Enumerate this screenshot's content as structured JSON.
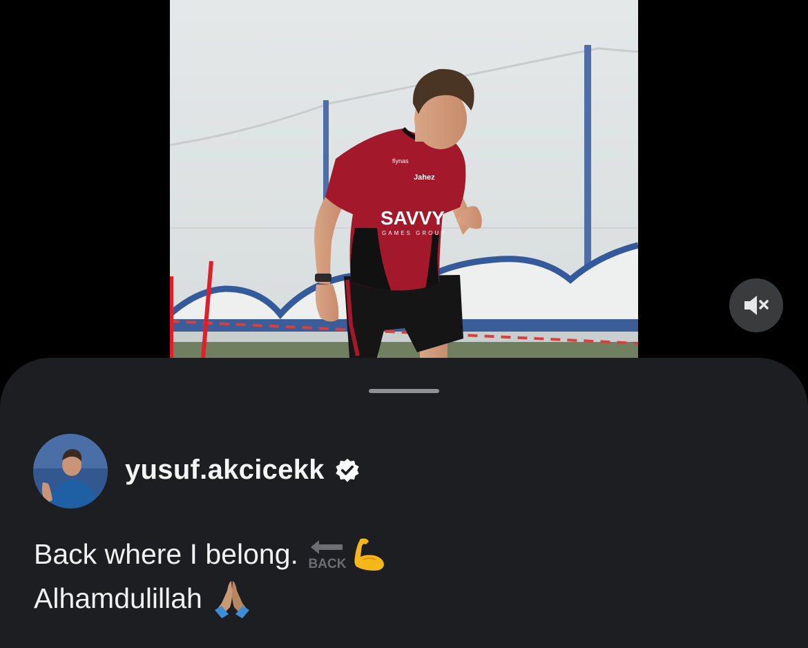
{
  "post": {
    "username": "yusuf.akcicekk",
    "verified": true,
    "caption_line1": "Back where I belong.",
    "caption_line2": "Alhamdulillah",
    "caption_line1_emojis": [
      "back-arrow-emoji",
      "flexed-biceps-emoji"
    ],
    "caption_line2_emojis": [
      "folded-hands-emoji"
    ]
  },
  "media": {
    "type": "video",
    "muted": true,
    "shirt_text": {
      "main_sponsor": "SAVVY",
      "sub_sponsor": "GAMES GROUP",
      "sponsor_top": "flynas",
      "chest_left": "Jahez"
    }
  },
  "emoji_labels": {
    "back": "BACK"
  },
  "colors": {
    "sheet_bg": "#1c1e22",
    "page_bg": "#000000",
    "mute_bg": "#3a3b3d",
    "text": "#f2f2f2",
    "jersey_red": "#a3182a"
  },
  "icons": [
    "speaker-muted-icon",
    "verified-badge-icon"
  ]
}
